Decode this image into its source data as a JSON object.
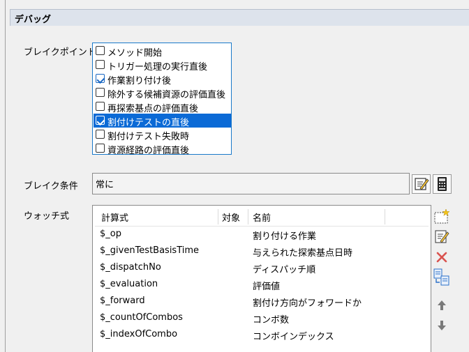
{
  "section": {
    "title": "デバッグ"
  },
  "breakpoints": {
    "label": "ブレイクポイント",
    "items": [
      {
        "label": "メソッド開始",
        "checked": false,
        "selected": false
      },
      {
        "label": "トリガー処理の実行直後",
        "checked": false,
        "selected": false
      },
      {
        "label": "作業割り付け後",
        "checked": true,
        "selected": false
      },
      {
        "label": "除外する候補資源の評価直後",
        "checked": false,
        "selected": false
      },
      {
        "label": "再探索基点の評価直後",
        "checked": false,
        "selected": false
      },
      {
        "label": "割付けテストの直後",
        "checked": true,
        "selected": true
      },
      {
        "label": "割付けテスト失敗時",
        "checked": false,
        "selected": false
      },
      {
        "label": "資源経路の評価直後",
        "checked": false,
        "selected": false
      }
    ]
  },
  "condition": {
    "label": "ブレイク条件",
    "value": "常に",
    "edit_icon": "edit-note-icon",
    "calc_icon": "calculator-icon"
  },
  "watch": {
    "label": "ウォッチ式",
    "columns": [
      "計算式",
      "対象",
      "名前"
    ],
    "rows": [
      {
        "expr": "$_op",
        "target": "",
        "name": "割り付ける作業"
      },
      {
        "expr": "$_givenTestBasisTime",
        "target": "",
        "name": "与えられた探索基点日時"
      },
      {
        "expr": "$_dispatchNo",
        "target": "",
        "name": "ディスパッチ順"
      },
      {
        "expr": "$_evaluation",
        "target": "",
        "name": "評価値"
      },
      {
        "expr": "$_forward",
        "target": "",
        "name": "割付け方向がフォワードか"
      },
      {
        "expr": "$_countOfCombos",
        "target": "",
        "name": "コンボ数"
      },
      {
        "expr": "$_indexOfCombo",
        "target": "",
        "name": "コンボインデックス"
      }
    ],
    "side_icons": [
      "new-icon",
      "edit-icon",
      "delete-icon",
      "copy-icon",
      "move-up-icon",
      "move-down-icon"
    ]
  },
  "colors": {
    "selection": "#0b6ad6",
    "header_bg": "#dde3ec",
    "delete": "#d9534f"
  }
}
